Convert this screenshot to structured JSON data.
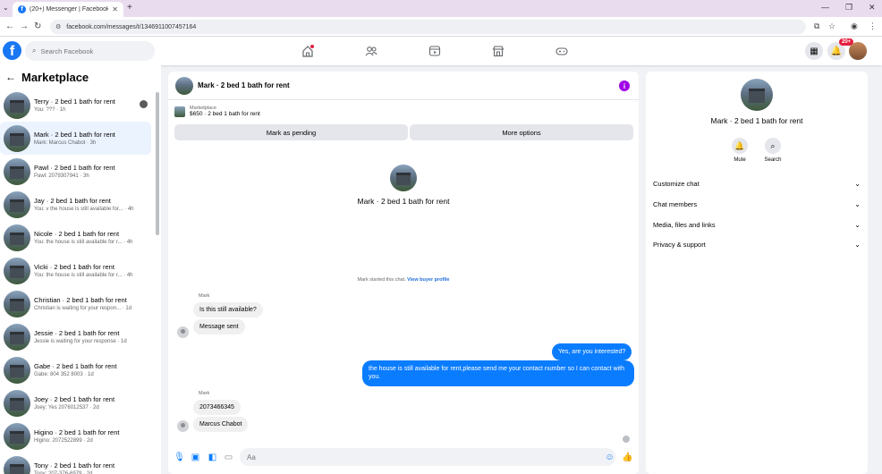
{
  "browser": {
    "tab_title": "(20+) Messenger | Facebook",
    "url": "facebook.com/messages/t/1346911007457164"
  },
  "header": {
    "search_placeholder": "Search Facebook",
    "notif_count": "20+"
  },
  "sidebar": {
    "title": "Marketplace",
    "conversations": [
      {
        "name": "Terry · 2 bed 1 bath for rent",
        "preview": "You: ??? · 1h",
        "active": false,
        "seen": true
      },
      {
        "name": "Mark · 2 bed 1 bath for rent",
        "preview": "Mark: Marcus Chabot · 3h",
        "active": true,
        "seen": false
      },
      {
        "name": "Pawl · 2 bed 1 bath for rent",
        "preview": "Pawl: 2079307941 · 3h",
        "active": false,
        "seen": false
      },
      {
        "name": "Jay · 2 bed 1 bath for rent",
        "preview": "You: v the house is still available for... · 4h",
        "active": false,
        "seen": false
      },
      {
        "name": "Nicole · 2 bed 1 bath for rent",
        "preview": "You: the house is still available for r... · 4h",
        "active": false,
        "seen": false
      },
      {
        "name": "Vicki · 2 bed 1 bath for rent",
        "preview": "You: the house is still available for r... · 4h",
        "active": false,
        "seen": false
      },
      {
        "name": "Christian · 2 bed 1 bath for rent",
        "preview": "Christian is waiting for your respon... · 1d",
        "active": false,
        "seen": false
      },
      {
        "name": "Jessie · 2 bed 1 bath for rent",
        "preview": "Jessie is waiting for your response · 1d",
        "active": false,
        "seen": false
      },
      {
        "name": "Gabe · 2 bed 1 bath for rent",
        "preview": "Gabe: 804 352 8003 · 1d",
        "active": false,
        "seen": false
      },
      {
        "name": "Joey · 2 bed 1 bath for rent",
        "preview": "Joey: Yes 2076012537 · 2d",
        "active": false,
        "seen": false
      },
      {
        "name": "Higino · 2 bed 1 bath for rent",
        "preview": "Higino: 2072522899 · 2d",
        "active": false,
        "seen": false
      },
      {
        "name": "Tony · 2 bed 1 bath for rent",
        "preview": "Tony: 207-376-6979 · 2d",
        "active": false,
        "seen": false
      }
    ]
  },
  "chat": {
    "title": "Mark · 2 bed 1 bath for rent",
    "marketplace_label": "Marketplace",
    "listing": "$650 · 2 bed 1 bath for rent",
    "btn_pending": "Mark as pending",
    "btn_more": "More options",
    "center_name": "Mark · 2 bed 1 bath for rent",
    "started_text": "Mark started this chat.",
    "started_link": "View buyer profile",
    "sender1": "Mark",
    "msg_in_1": "Is this still available?",
    "msg_in_2": "Message sent",
    "msg_out_1": "Yes, are you interested?",
    "msg_out_2": "the house is still available for rent,please send me your contact number so I can contact with you.",
    "sender2": "Mark",
    "msg_in_3": "2073466345",
    "msg_in_4": "Marcus Chabot",
    "input_placeholder": "Aa"
  },
  "info_panel": {
    "name": "Mark · 2 bed 1 bath for rent",
    "mute": "Mute",
    "search": "Search",
    "rows": [
      "Customize chat",
      "Chat members",
      "Media, files and links",
      "Privacy & support"
    ]
  }
}
